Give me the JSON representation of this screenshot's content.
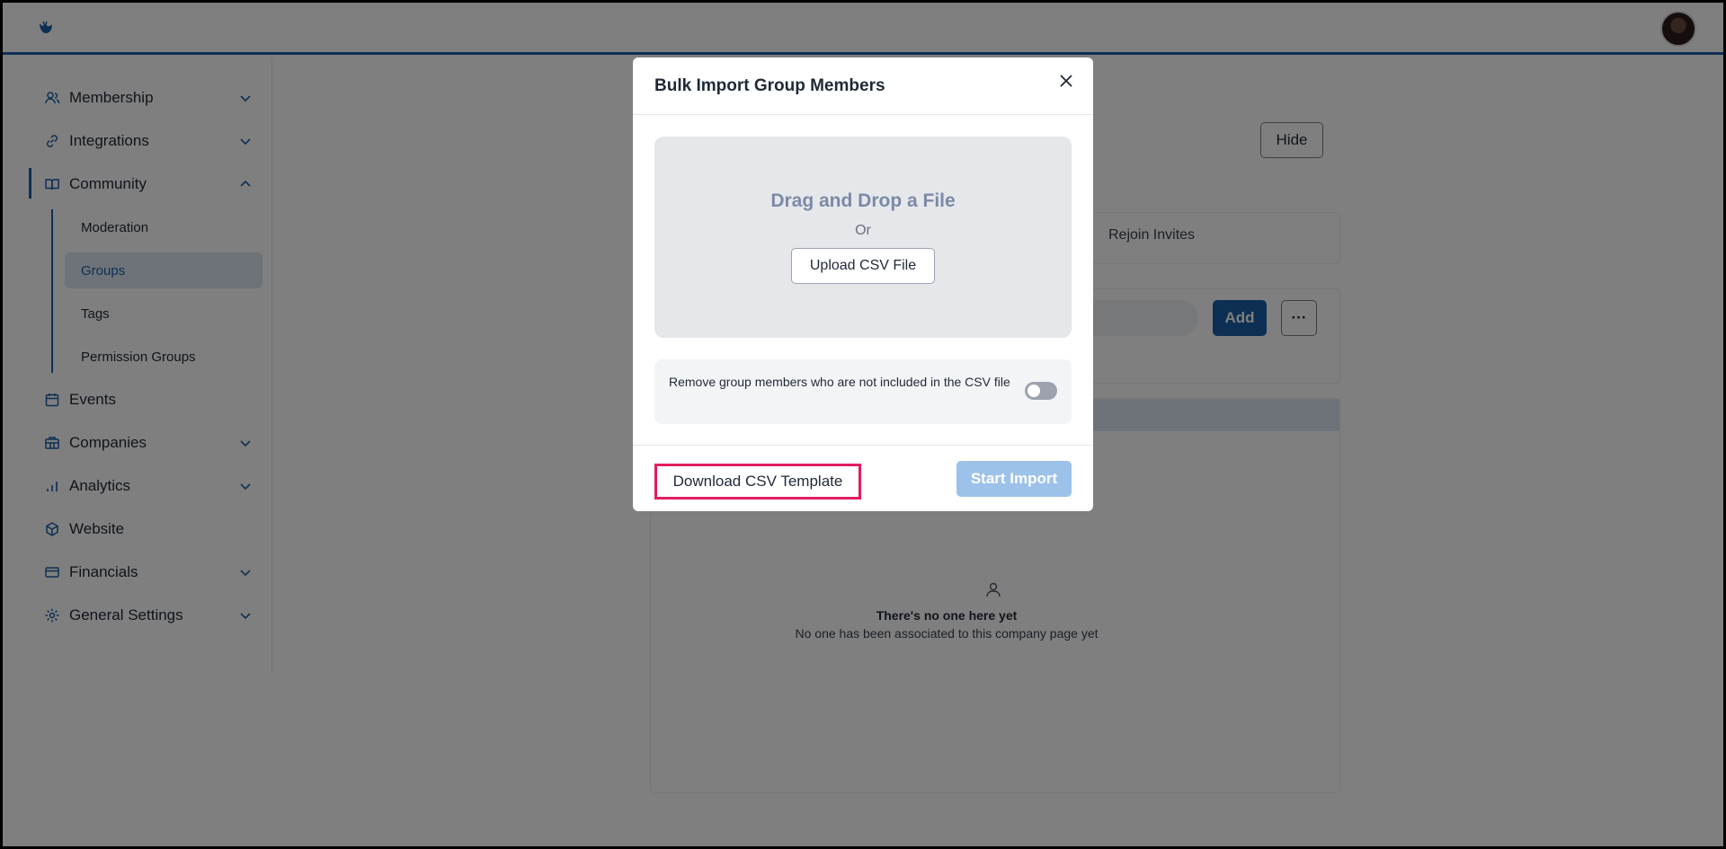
{
  "app": {
    "logo_icon": "brand-logo-icon",
    "accent": "#1c5fa8"
  },
  "sidebar": {
    "items": [
      {
        "label": "Membership",
        "icon": "users-icon",
        "expandable": true
      },
      {
        "label": "Integrations",
        "icon": "link-icon",
        "expandable": true
      },
      {
        "label": "Community",
        "icon": "book-icon",
        "expandable": true,
        "expanded": true
      },
      {
        "label": "Events",
        "icon": "calendar-icon",
        "expandable": false
      },
      {
        "label": "Companies",
        "icon": "building-icon",
        "expandable": true
      },
      {
        "label": "Analytics",
        "icon": "bar-chart-icon",
        "expandable": true
      },
      {
        "label": "Website",
        "icon": "cube-icon",
        "expandable": false
      },
      {
        "label": "Financials",
        "icon": "credit-card-icon",
        "expandable": true
      },
      {
        "label": "General Settings",
        "icon": "gear-icon",
        "expandable": true
      }
    ],
    "community_sub": [
      {
        "label": "Moderation"
      },
      {
        "label": "Groups",
        "selected": true
      },
      {
        "label": "Tags"
      },
      {
        "label": "Permission Groups"
      }
    ]
  },
  "background": {
    "hide_label": "Hide",
    "tab_rejoin": "Rejoin Invites",
    "add_label": "Add",
    "more_label": "···",
    "empty_title": "There's no one here yet",
    "empty_sub": "No one has been associated to this company page yet"
  },
  "modal": {
    "title": "Bulk Import Group Members",
    "dropzone_title": "Drag and Drop a File",
    "dropzone_or": "Or",
    "upload_label": "Upload CSV File",
    "toggle_text": "Remove group members who are not included in the CSV file",
    "toggle_on": false,
    "download_label": "Download CSV Template",
    "start_label": "Start Import"
  }
}
